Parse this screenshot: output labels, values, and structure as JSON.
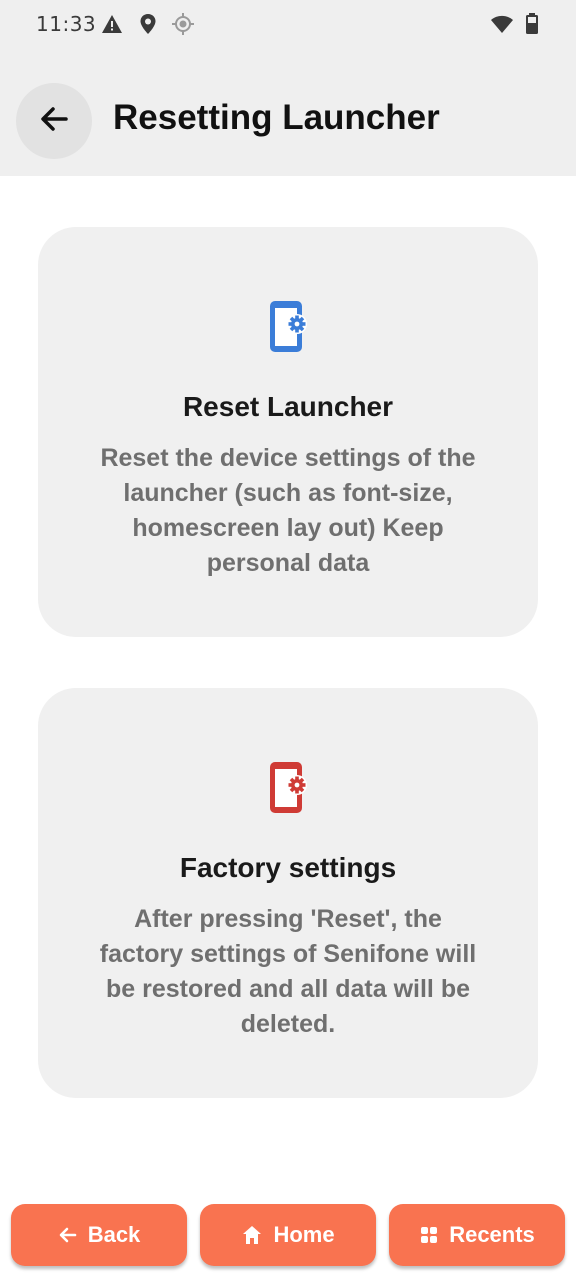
{
  "status_bar": {
    "time": "11:33",
    "icons": [
      "warning-icon",
      "location-pin-icon",
      "gps-icon",
      "wifi-icon",
      "battery-icon"
    ]
  },
  "header": {
    "title": "Resetting Launcher",
    "back_icon": "arrow-left-icon"
  },
  "cards": [
    {
      "title": "Reset Launcher",
      "description_lines": [
        "Reset the device settings of the",
        "launcher (such as font-size,",
        "homescreen lay out) Keep",
        "personal data"
      ],
      "icon": "phone-settings-icon",
      "icon_color": "#3b7dd8"
    },
    {
      "title": "Factory settings",
      "description_lines": [
        "After pressing 'Reset', the",
        "factory settings of Senifone will",
        "be restored and all data will be",
        "deleted."
      ],
      "icon": "phone-settings-icon",
      "icon_color": "#cf3b35"
    }
  ],
  "bottom_nav": {
    "back_label": "Back",
    "home_label": "Home",
    "recents_label": "Recents",
    "accent": "#f97350"
  }
}
